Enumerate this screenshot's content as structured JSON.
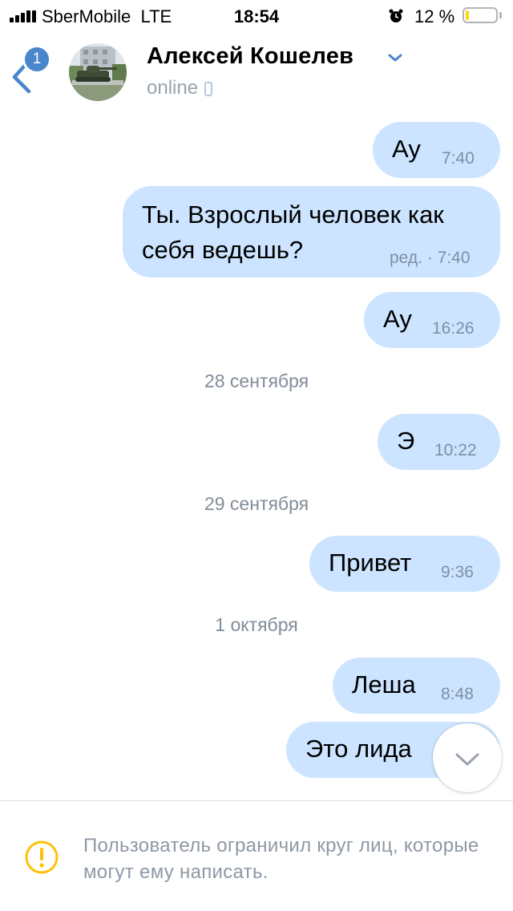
{
  "status_bar": {
    "carrier": "SberMobile",
    "network": "LTE",
    "time": "18:54",
    "battery_percent": "12 %",
    "battery_level": 0.12
  },
  "header": {
    "unread_badge": "1",
    "contact_name": "Алексей Кошелев",
    "status": "online",
    "accent_color": "#4986cc"
  },
  "messages": [
    {
      "text": "Ау",
      "time": "7:40"
    },
    {
      "text_lines": [
        "Ты. Взрослый человек как",
        "себя ведешь?"
      ],
      "edited_label": "ред. · 7:40"
    },
    {
      "text": "Ау",
      "time": "16:26"
    },
    {
      "date": "28 сентября"
    },
    {
      "text": "Э",
      "time": "10:22"
    },
    {
      "date": "29 сентября"
    },
    {
      "text": "Привет",
      "time": "9:36"
    },
    {
      "date": "1 октября"
    },
    {
      "text": "Леша",
      "time": "8:48"
    },
    {
      "text": "Это лида"
    }
  ],
  "notice": {
    "icon": "warning-circle-icon",
    "text": "Пользователь ограничил круг лиц, которые могут ему написать."
  },
  "colors": {
    "bubble_outgoing": "#cce4ff",
    "time_text": "#7f8fa4",
    "warning": "#ffc107"
  }
}
